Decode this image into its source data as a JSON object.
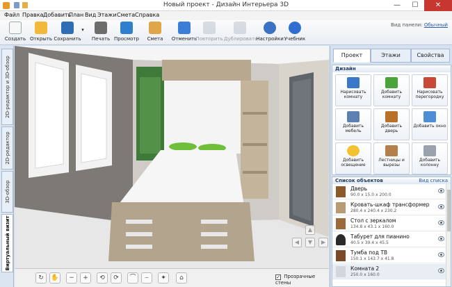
{
  "window": {
    "title": "Новый проект - Дизайн Интерьера 3D",
    "minimize": "—",
    "maximize": "☐",
    "close": "✕"
  },
  "menu": [
    "Файл",
    "Правка",
    "Добавить",
    "План",
    "Вид",
    "Этажи",
    "Смета",
    "Справка"
  ],
  "toolbar": {
    "buttons": [
      {
        "label": "Создать",
        "icon": "new-file-icon",
        "color": "#f4f4f4"
      },
      {
        "label": "Открыть",
        "icon": "folder-icon",
        "color": "#f1b83a"
      },
      {
        "label": "Сохранить",
        "icon": "save-icon",
        "color": "#2f6db5"
      },
      {
        "label": "Печать",
        "icon": "printer-icon",
        "color": "#6d6d6d"
      },
      {
        "label": "Просмотр",
        "icon": "monitor-icon",
        "color": "#2f7fd1"
      },
      {
        "label": "Смета",
        "icon": "estimate-icon",
        "color": "#e0a548"
      },
      {
        "label": "Отменить",
        "icon": "undo-icon",
        "color": "#3b7dd8"
      },
      {
        "label": "Повторить",
        "icon": "redo-icon",
        "color": "#9aa7b6"
      },
      {
        "label": "Дублировать",
        "icon": "duplicate-icon",
        "color": "#9aa7b6"
      },
      {
        "label": "Настройки",
        "icon": "gear-icon",
        "color": "#3b72c4"
      },
      {
        "label": "Учебник",
        "icon": "help-icon",
        "color": "#2f6fcf"
      }
    ],
    "panel_view_label": "Вид панели:",
    "panel_view_value": "Обычный"
  },
  "left_tabs": [
    "2D-редактор и 3D-обзор",
    "2D-редактор",
    "3D-обзор",
    "Виртуальный визит"
  ],
  "viewport": {
    "transparent_walls_label": "Прозрачные стены",
    "transparent_walls_checked": true,
    "nav_arrows": {
      "up": "▲",
      "down": "▼",
      "left": "◀",
      "right": "▶"
    }
  },
  "bottom_tools": [
    {
      "name": "rotate-360-icon",
      "glyph": "↻"
    },
    {
      "name": "hand-icon",
      "glyph": "✋"
    },
    {
      "name": "zoom-out-icon",
      "glyph": "−"
    },
    {
      "name": "zoom-in-icon",
      "glyph": "+"
    },
    {
      "name": "rotate-left-icon",
      "glyph": "⟲"
    },
    {
      "name": "rotate-right-icon",
      "glyph": "⟳"
    },
    {
      "name": "tilt-up-icon",
      "glyph": "⌒"
    },
    {
      "name": "tilt-down-icon",
      "glyph": "⌣"
    },
    {
      "name": "light-icon",
      "glyph": "✦"
    },
    {
      "name": "home-icon",
      "glyph": "⌂"
    }
  ],
  "right_panel": {
    "tabs": [
      "Проект",
      "Этажи",
      "Свойства"
    ],
    "design_header": "Дизайн",
    "design_buttons": [
      {
        "label": "Нарисовать комнату",
        "icon": "draw-room-icon",
        "color": "#3a79c8"
      },
      {
        "label": "Добавить комнату",
        "icon": "add-room-icon",
        "color": "#4aa43a"
      },
      {
        "label": "Нарисовать перегородку",
        "icon": "partition-icon",
        "color": "#c84a36"
      },
      {
        "label": "Добавить мебель",
        "icon": "furniture-icon",
        "color": "#5e7fb1"
      },
      {
        "label": "Добавить дверь",
        "icon": "door-icon",
        "color": "#b8702b"
      },
      {
        "label": "Добавить окно",
        "icon": "window-icon",
        "color": "#4d8fd6"
      },
      {
        "label": "Добавить освещение",
        "icon": "lamp-icon",
        "color": "#f2c230"
      },
      {
        "label": "Лестницы и вырезы",
        "icon": "stairs-icon",
        "color": "#b4804a"
      },
      {
        "label": "Добавить колонну",
        "icon": "column-icon",
        "color": "#9aa3ad"
      }
    ],
    "objects_header": "Список объектов",
    "objects_view_link": "Вид списка",
    "objects": [
      {
        "name": "Дверь",
        "size": "90.0 x 15.0 x 200.0",
        "thumb": "#8b5a2b"
      },
      {
        "name": "Кровать-шкаф трансформер",
        "size": "280.4 x 240.4 x 230.2",
        "thumb": "#b89b72"
      },
      {
        "name": "Стол с зеркалом",
        "size": "134.8 x 43.1 x 160.0",
        "thumb": "#9c6b3d"
      },
      {
        "name": "Табурет для пианино",
        "size": "40.5 x 39.4 x 45.5",
        "thumb": "#2b2b2b"
      },
      {
        "name": "Тумба под ТВ",
        "size": "150.1 x 143.7 x 41.8",
        "thumb": "#7a4a2a"
      },
      {
        "name": "Комната 2",
        "size": "250.0 x 160.0",
        "thumb": "#d2d7de"
      }
    ]
  }
}
